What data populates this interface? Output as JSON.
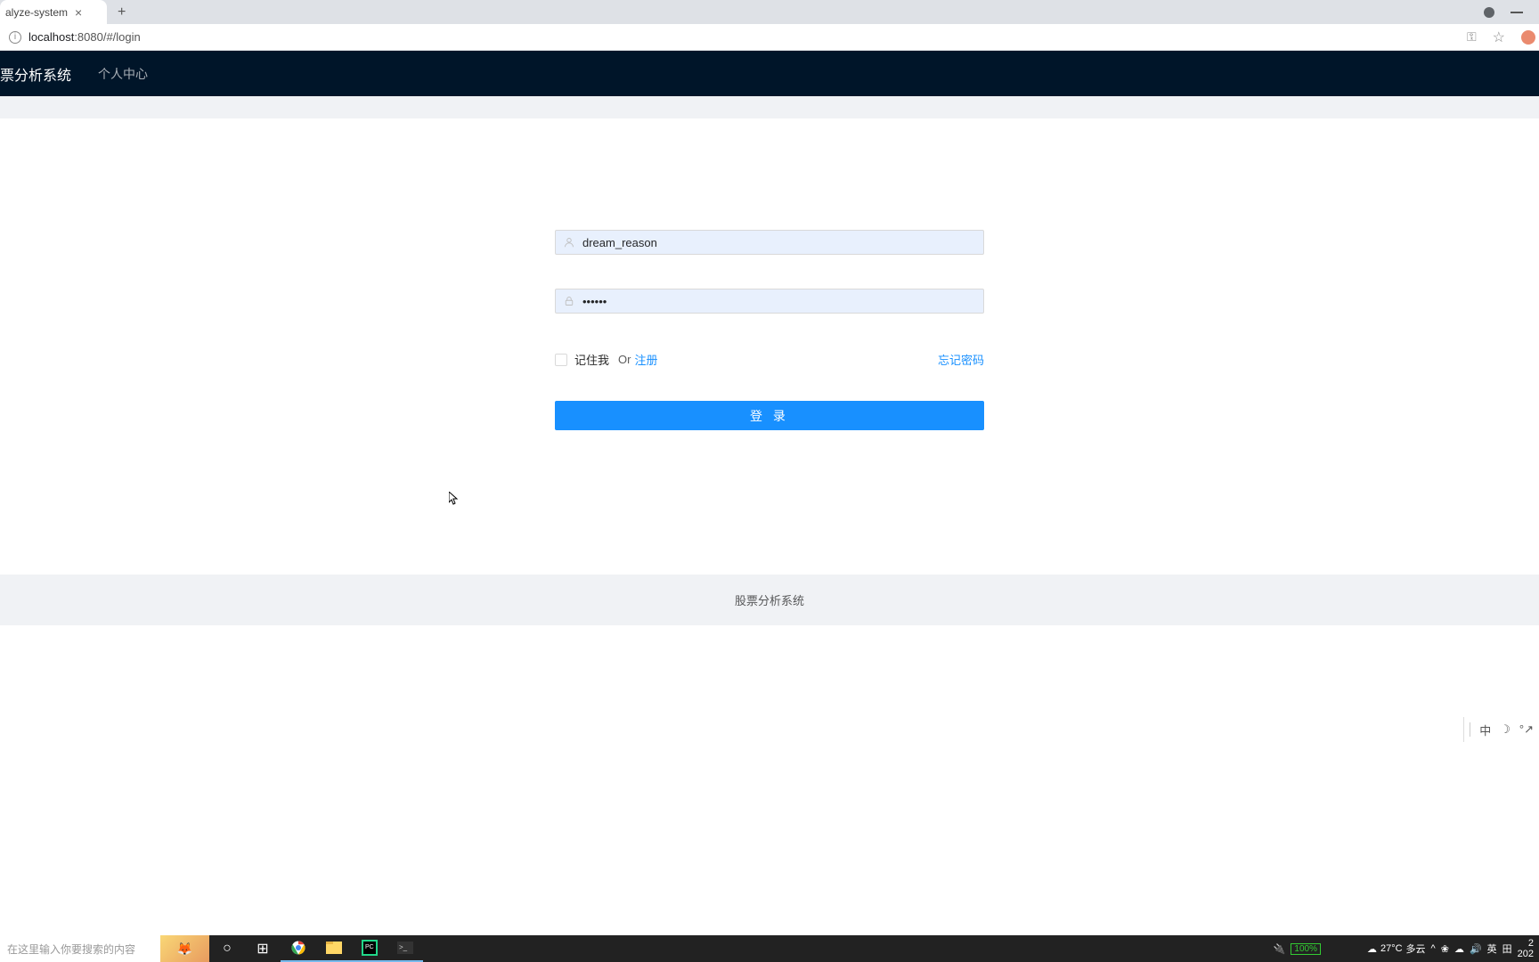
{
  "browser": {
    "tab_title": "alyze-system",
    "url_host": "localhost",
    "url_port_path": ":8080/#/login"
  },
  "nav": {
    "brand": "票分析系统",
    "personal_center": "个人中心"
  },
  "form": {
    "username_value": "dream_reason",
    "password_value": "••••••",
    "remember_label": "记住我",
    "or_label": "Or",
    "register_label": "注册",
    "forgot_label": "忘记密码",
    "login_button": "登 录"
  },
  "footer": {
    "text": "股票分析系统"
  },
  "ime": {
    "lang": "中",
    "arrow": "↗"
  },
  "taskbar": {
    "search_placeholder": "在这里输入你要搜索的内容",
    "battery": "100%",
    "weather_temp": "27°C",
    "weather_desc": "多云",
    "input_method": "英",
    "layout": "田",
    "time1": "2",
    "time2": "202"
  }
}
